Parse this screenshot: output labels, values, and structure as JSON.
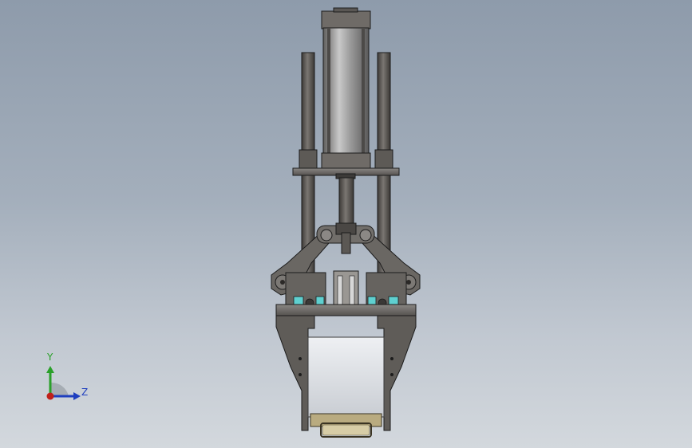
{
  "viewport": {
    "background_top": "#8e9bab",
    "background_bottom": "#d3d8dd"
  },
  "model": {
    "description_icon": "gripper-assembly-icon",
    "colors": {
      "steel_dark": "#4a4744",
      "steel_mid": "#6e6b67",
      "steel_light": "#9a9896",
      "cylinder": "#8d8c8c",
      "cylinder_highlight": "#c8c8c8",
      "outline": "#1c1c1c",
      "cyan_part": "#5fd0d0",
      "brass_tray": "#b9ab80",
      "white_block": "#e4e6ea"
    }
  },
  "triad": {
    "y_label": "Y",
    "z_label": "Z",
    "y_color": "#2aa02a",
    "z_color": "#1f3fbf",
    "origin_color": "#c0201a"
  }
}
